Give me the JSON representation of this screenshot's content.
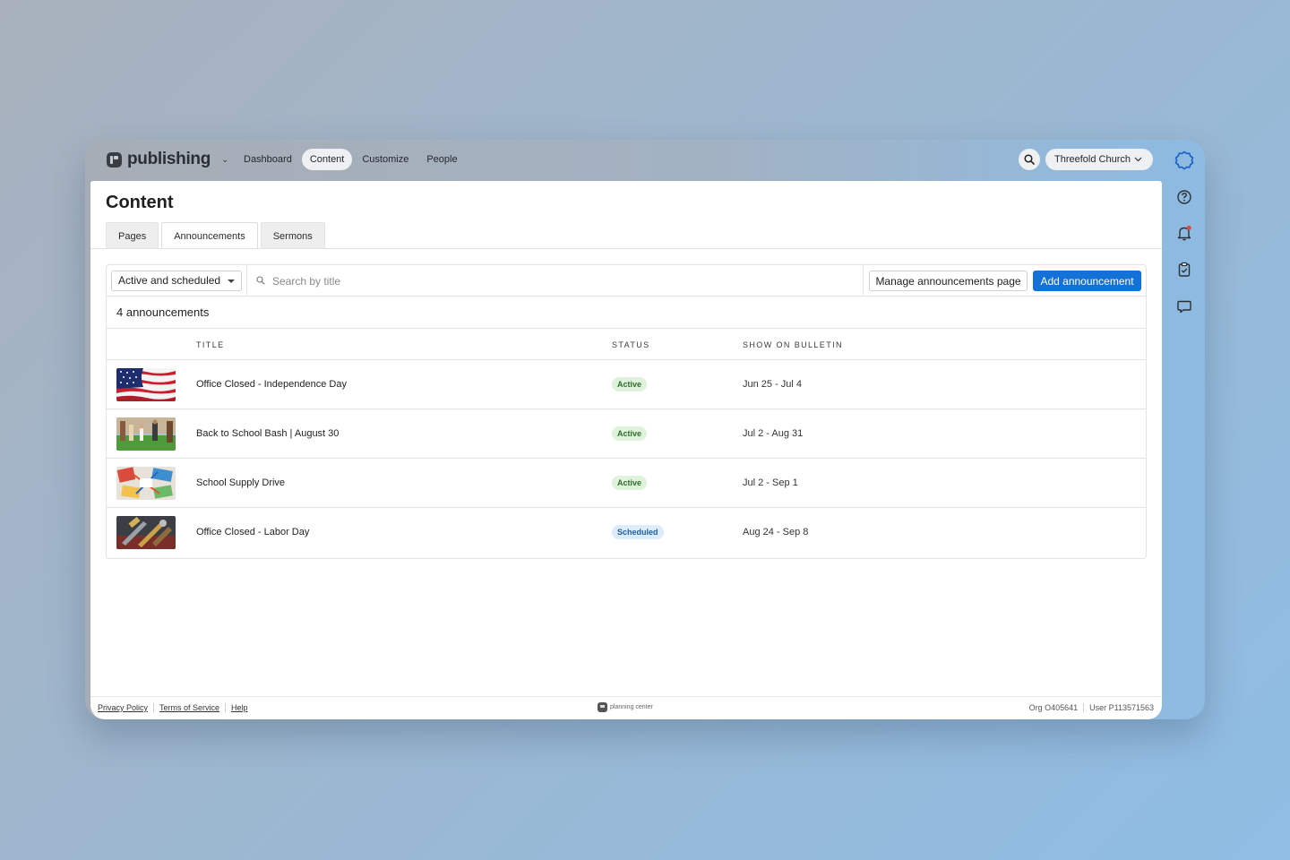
{
  "app": {
    "brand": "publishing",
    "nav": [
      "Dashboard",
      "Content",
      "Customize",
      "People"
    ],
    "active_nav": "Content",
    "org_name": "Threefold Church"
  },
  "page": {
    "title": "Content",
    "tabs": [
      "Pages",
      "Announcements",
      "Sermons"
    ],
    "active_tab": "Announcements"
  },
  "toolbar": {
    "filter_value": "Active and scheduled",
    "search_placeholder": "Search by title",
    "manage_label": "Manage announcements page",
    "add_label": "Add announcement"
  },
  "list": {
    "count_label": "4 announcements",
    "columns": [
      "TITLE",
      "STATUS",
      "SHOW ON BULLETIN"
    ],
    "rows": [
      {
        "title": "Office Closed - Independence Day",
        "status": "Active",
        "dates": "Jun 25 - Jul 4",
        "thumb": "american-flag-image"
      },
      {
        "title": "Back to School Bash | August 30",
        "status": "Active",
        "dates": "Jul 2 - Aug 31",
        "thumb": "kids-playing-image"
      },
      {
        "title": "School Supply Drive",
        "status": "Active",
        "dates": "Jul 2 - Sep 1",
        "thumb": "school-supplies-image"
      },
      {
        "title": "Office Closed - Labor Day",
        "status": "Scheduled",
        "dates": "Aug 24 - Sep 8",
        "thumb": "work-tools-image"
      }
    ]
  },
  "footer": {
    "links": [
      "Privacy Policy",
      "Terms of Service",
      "Help"
    ],
    "logo_text": "planning center",
    "org_id": "Org O405641",
    "user_id": "User P113571563"
  },
  "colors": {
    "primary": "#1471d8",
    "active_badge_bg": "#dff2dc",
    "active_badge_text": "#2f6e2a",
    "scheduled_badge_bg": "#dcecfb",
    "scheduled_badge_text": "#1f5e9e"
  }
}
